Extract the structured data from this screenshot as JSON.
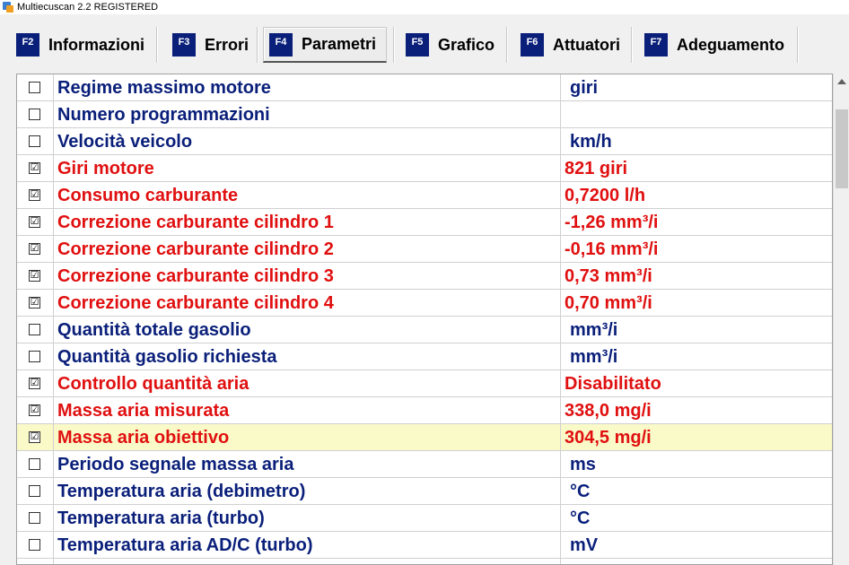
{
  "window": {
    "title": "Multiecuscan 2.2 REGISTERED"
  },
  "tabs": [
    {
      "key": "F2",
      "label": "Informazioni"
    },
    {
      "key": "F3",
      "label": "Errori"
    },
    {
      "key": "F4",
      "label": "Parametri"
    },
    {
      "key": "F5",
      "label": "Grafico"
    },
    {
      "key": "F6",
      "label": "Attuatori"
    },
    {
      "key": "F7",
      "label": "Adeguamento"
    }
  ],
  "active_tab": "Parametri",
  "colors": {
    "inactive": "#0a1f7a",
    "active": "#e01010",
    "highlight": "#fafac8",
    "fkey_bg": "#0a1f7a"
  },
  "parameters": [
    {
      "checked": false,
      "check_mark": "",
      "name": "Regime massimo motore",
      "value": "giri"
    },
    {
      "checked": false,
      "check_mark": "",
      "name": "Numero programmazioni",
      "value": ""
    },
    {
      "checked": false,
      "check_mark": "",
      "name": "Velocità veicolo",
      "value": "km/h"
    },
    {
      "checked": true,
      "check_mark": "☑",
      "name": "Giri motore",
      "value": "821 giri"
    },
    {
      "checked": true,
      "check_mark": "☑",
      "name": "Consumo carburante",
      "value": "0,7200 l/h"
    },
    {
      "checked": true,
      "check_mark": "☑",
      "name": "Correzione carburante cilindro 1",
      "value": "-1,26 mm³/i"
    },
    {
      "checked": true,
      "check_mark": "☑",
      "name": "Correzione carburante cilindro 2",
      "value": "-0,16 mm³/i"
    },
    {
      "checked": true,
      "check_mark": "☑",
      "name": "Correzione carburante cilindro 3",
      "value": "0,73 mm³/i"
    },
    {
      "checked": true,
      "check_mark": "☑",
      "name": "Correzione carburante cilindro 4",
      "value": "0,70 mm³/i"
    },
    {
      "checked": false,
      "check_mark": "",
      "name": "Quantità totale gasolio",
      "value": "mm³/i"
    },
    {
      "checked": false,
      "check_mark": "",
      "name": "Quantità gasolio richiesta",
      "value": "mm³/i"
    },
    {
      "checked": true,
      "check_mark": "☑",
      "name": "Controllo quantità aria",
      "value": "Disabilitato"
    },
    {
      "checked": true,
      "check_mark": "☑",
      "name": "Massa aria misurata",
      "value": "338,0 mg/i"
    },
    {
      "checked": true,
      "check_mark": "☑",
      "name": "Massa aria obiettivo",
      "value": "304,5 mg/i",
      "highlighted": true
    },
    {
      "checked": false,
      "check_mark": "",
      "name": "Periodo segnale massa aria",
      "value": "ms"
    },
    {
      "checked": false,
      "check_mark": "",
      "name": "Temperatura aria (debimetro)",
      "value": "°C"
    },
    {
      "checked": false,
      "check_mark": "",
      "name": "Temperatura aria (turbo)",
      "value": "°C"
    },
    {
      "checked": false,
      "check_mark": "",
      "name": "Temperatura aria AD/C (turbo)",
      "value": "mV"
    },
    {
      "checked": false,
      "check_mark": "",
      "name": "",
      "value": ""
    }
  ]
}
